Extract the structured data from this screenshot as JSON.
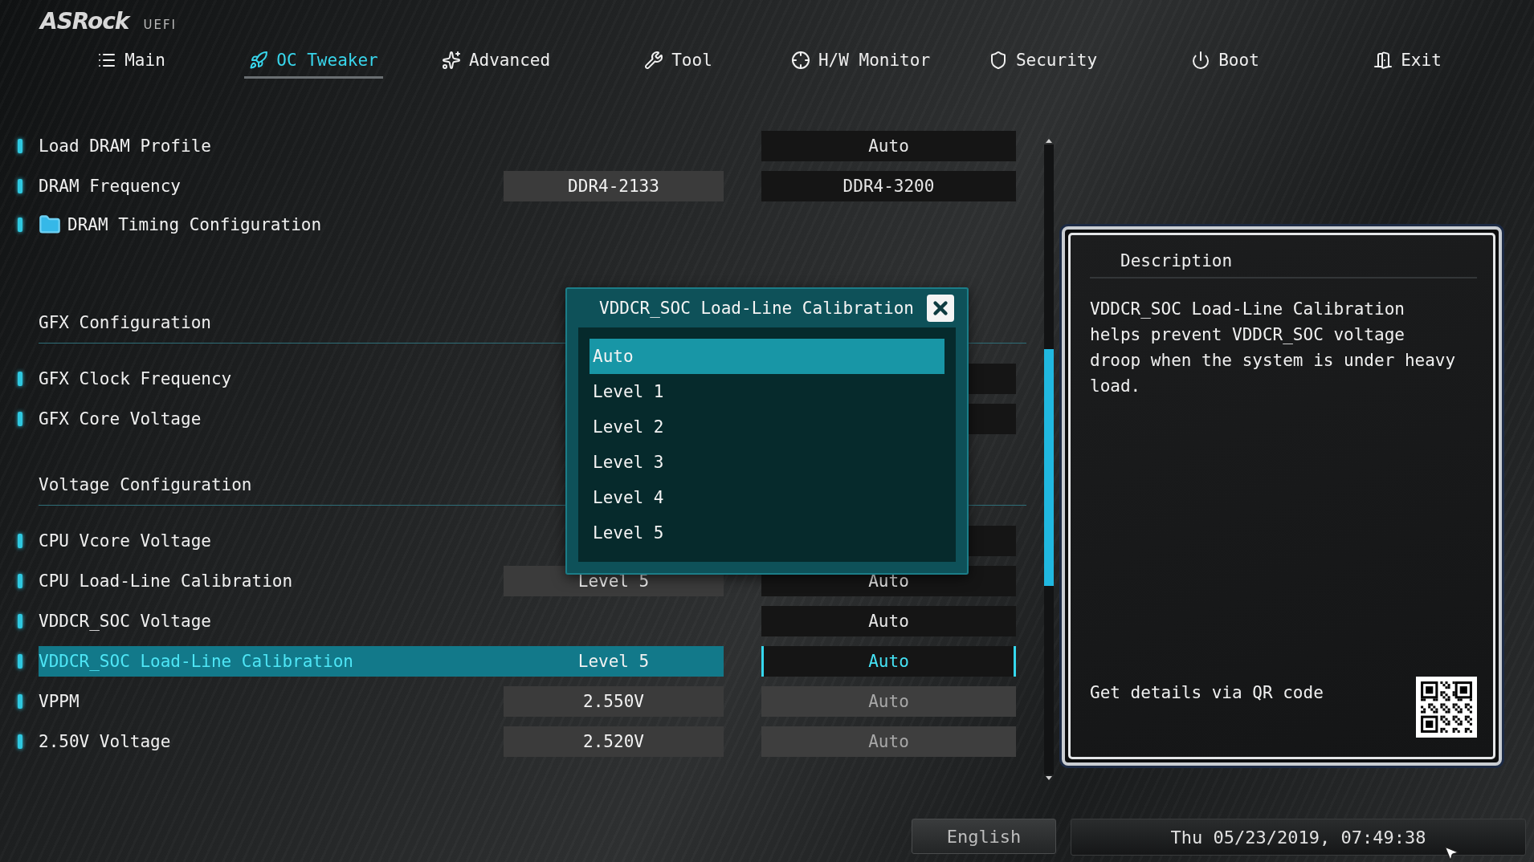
{
  "header": {
    "logo": "ASRock",
    "logo_suffix": "UEFI"
  },
  "tabs": [
    {
      "label": "Main",
      "selected": false
    },
    {
      "label": "OC Tweaker",
      "selected": true
    },
    {
      "label": "Advanced",
      "selected": false
    },
    {
      "label": "Tool",
      "selected": false
    },
    {
      "label": "H/W Monitor",
      "selected": false
    },
    {
      "label": "Security",
      "selected": false
    },
    {
      "label": "Boot",
      "selected": false
    },
    {
      "label": "Exit",
      "selected": false
    }
  ],
  "rows": [
    {
      "kind": "item",
      "label": "Load DRAM Profile",
      "selected": false,
      "disabled": false,
      "setting": "Auto"
    },
    {
      "kind": "item",
      "label": "DRAM Frequency",
      "selected": false,
      "disabled": false,
      "current": "DDR4-2133",
      "setting": "DDR4-3200"
    },
    {
      "kind": "folder",
      "label": "DRAM Timing Configuration",
      "selected": false
    },
    {
      "kind": "section",
      "label": "GFX Configuration",
      "selected": false
    },
    {
      "kind": "item",
      "label": "GFX Clock Frequency",
      "selected": false,
      "disabled": false,
      "setting_box": true
    },
    {
      "kind": "item",
      "label": "GFX Core Voltage",
      "selected": false,
      "disabled": false,
      "setting_box": true
    },
    {
      "kind": "section",
      "label": "Voltage Configuration",
      "selected": false
    },
    {
      "kind": "item",
      "label": "CPU Vcore Voltage",
      "selected": false,
      "disabled": false,
      "setting_box": true
    },
    {
      "kind": "item",
      "label": "CPU Load-Line Calibration",
      "selected": false,
      "disabled": false,
      "current": "Level 5",
      "setting": "Auto"
    },
    {
      "kind": "item",
      "label": "VDDCR_SOC Voltage",
      "selected": false,
      "disabled": false,
      "setting": "Auto"
    },
    {
      "kind": "item",
      "label": "VDDCR_SOC Load-Line Calibration",
      "selected": true,
      "disabled": false,
      "current": "Level 5",
      "setting": "Auto"
    },
    {
      "kind": "item",
      "label": "VPPM",
      "selected": false,
      "disabled": true,
      "current": "2.550V",
      "setting": "Auto"
    },
    {
      "kind": "item",
      "label": "2.50V Voltage",
      "selected": false,
      "disabled": true,
      "current": "2.520V",
      "setting": "Auto"
    }
  ],
  "popup": {
    "title": "VDDCR_SOC Load-Line Calibration",
    "options": [
      {
        "label": "Auto",
        "selected": true
      },
      {
        "label": "Level 1",
        "selected": false
      },
      {
        "label": "Level 2",
        "selected": false
      },
      {
        "label": "Level 3",
        "selected": false
      },
      {
        "label": "Level 4",
        "selected": false
      },
      {
        "label": "Level 5",
        "selected": false
      }
    ]
  },
  "description": {
    "title": "Description",
    "text": "VDDCR_SOC Load-Line Calibration helps prevent VDDCR_SOC voltage droop when the system is under heavy load.",
    "qr_hint": "Get details via QR code"
  },
  "footer": {
    "language": "English",
    "datetime": "Thu 05/23/2019, 07:49:38"
  }
}
